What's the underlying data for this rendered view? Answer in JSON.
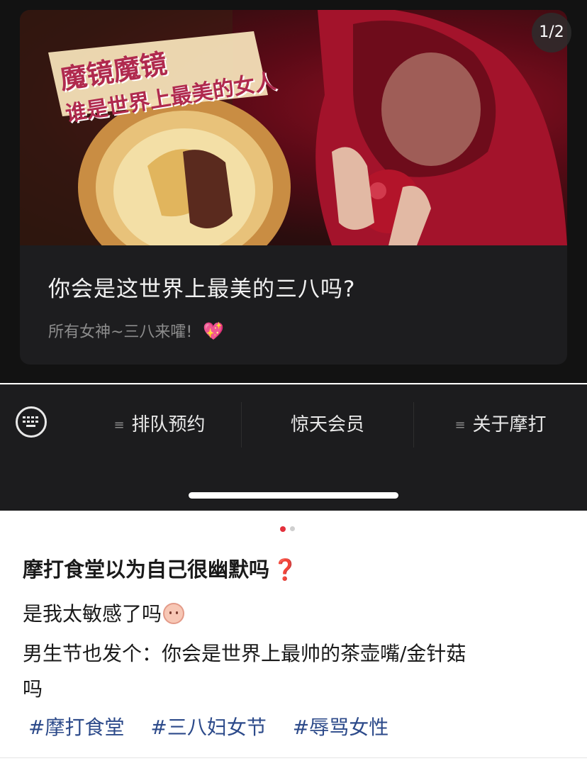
{
  "card": {
    "page_indicator": "1/2",
    "banner_text_line1": "魔镜魔镜",
    "banner_text_line2": "谁是世界上最美的女人",
    "title": "你会是这世界上最美的三八吗?",
    "subtitle": "所有女神~三八来嚯!",
    "subtitle_emoji": "💖"
  },
  "menu": {
    "items": [
      {
        "label": "排队预约",
        "icon": "menu-lines-icon"
      },
      {
        "label": "惊天会员",
        "icon": ""
      },
      {
        "label": "关于摩打",
        "icon": "menu-lines-icon"
      }
    ]
  },
  "carousel": {
    "total": 2,
    "active": 1,
    "active_color": "#e3303c",
    "inactive_color": "#cfcfcf"
  },
  "post": {
    "title": "摩打食堂以为自己很幽默吗",
    "title_mark": "❓",
    "line1": "是我太敏感了吗",
    "line2": "男生节也发个：你会是世界上最帅的茶壶嘴/金针菇",
    "line3": "吗",
    "tags": [
      "#摩打食堂",
      "#三八妇女节",
      "#辱骂女性"
    ]
  },
  "colors": {
    "dark_bg": "#121212",
    "tag_blue": "#2c4a8a",
    "accent_red": "#e3303c"
  }
}
